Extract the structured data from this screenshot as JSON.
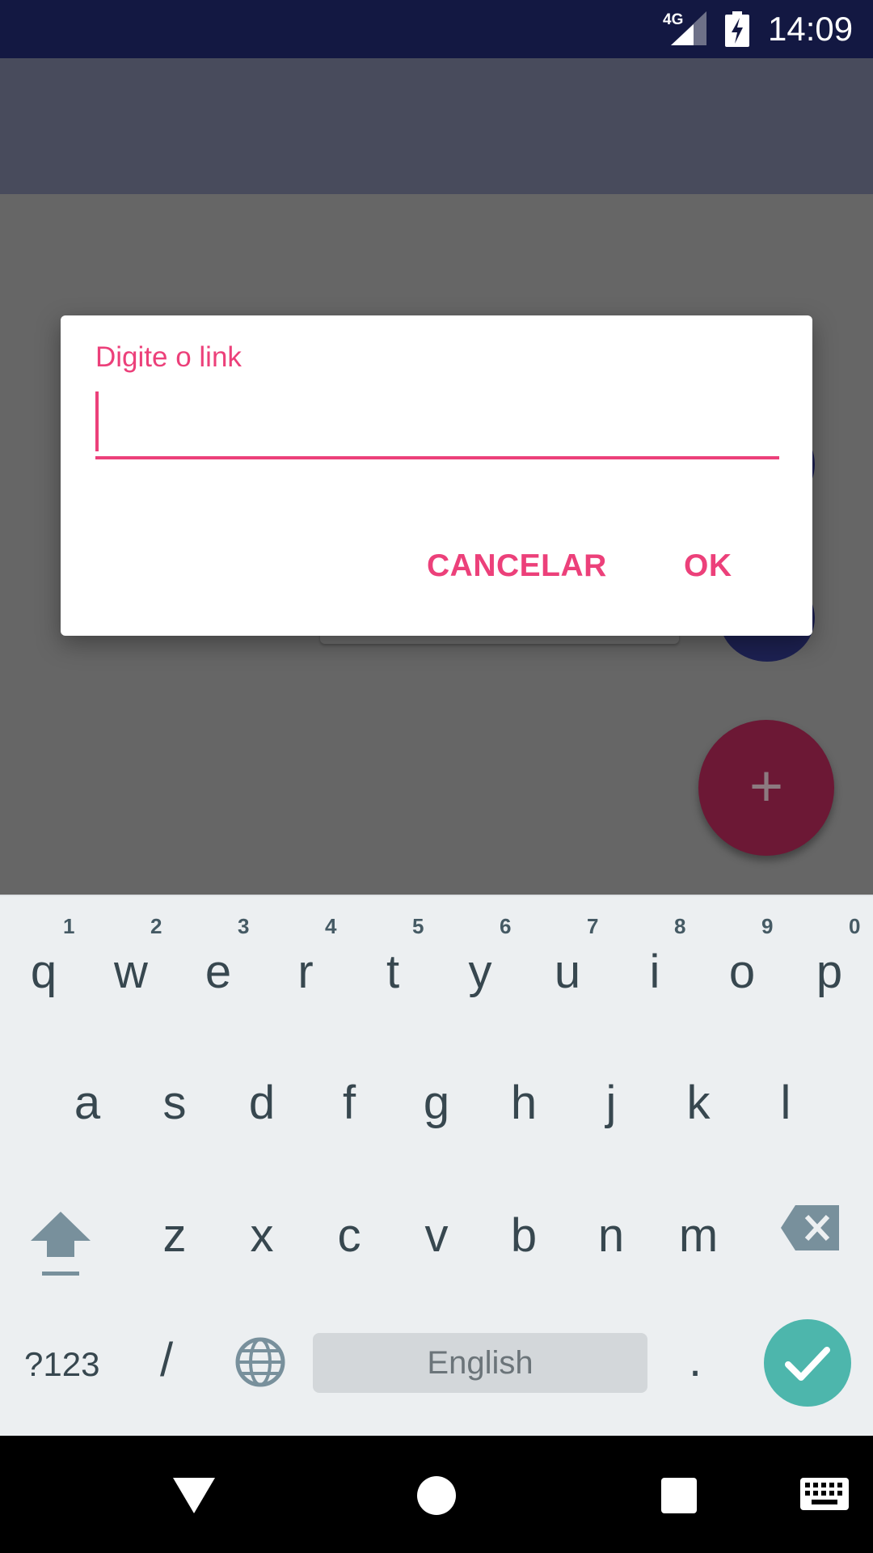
{
  "status_bar": {
    "network": "4G",
    "time": "14:09"
  },
  "dialog": {
    "hint": "Digite o link",
    "value": "",
    "cancel_label": "CANCELAR",
    "ok_label": "OK"
  },
  "fab": {
    "label": "+"
  },
  "keyboard": {
    "row1": [
      {
        "letter": "q",
        "num": "1"
      },
      {
        "letter": "w",
        "num": "2"
      },
      {
        "letter": "e",
        "num": "3"
      },
      {
        "letter": "r",
        "num": "4"
      },
      {
        "letter": "t",
        "num": "5"
      },
      {
        "letter": "y",
        "num": "6"
      },
      {
        "letter": "u",
        "num": "7"
      },
      {
        "letter": "i",
        "num": "8"
      },
      {
        "letter": "o",
        "num": "9"
      },
      {
        "letter": "p",
        "num": "0"
      }
    ],
    "row2": [
      "a",
      "s",
      "d",
      "f",
      "g",
      "h",
      "j",
      "k",
      "l"
    ],
    "row3": [
      "z",
      "x",
      "c",
      "v",
      "b",
      "n",
      "m"
    ],
    "symbols_label": "?123",
    "slash_label": "/",
    "space_label": "English",
    "period_label": "."
  },
  "colors": {
    "accent": "#ec407a",
    "status_bar": "#131842",
    "enter": "#4db6ac"
  }
}
